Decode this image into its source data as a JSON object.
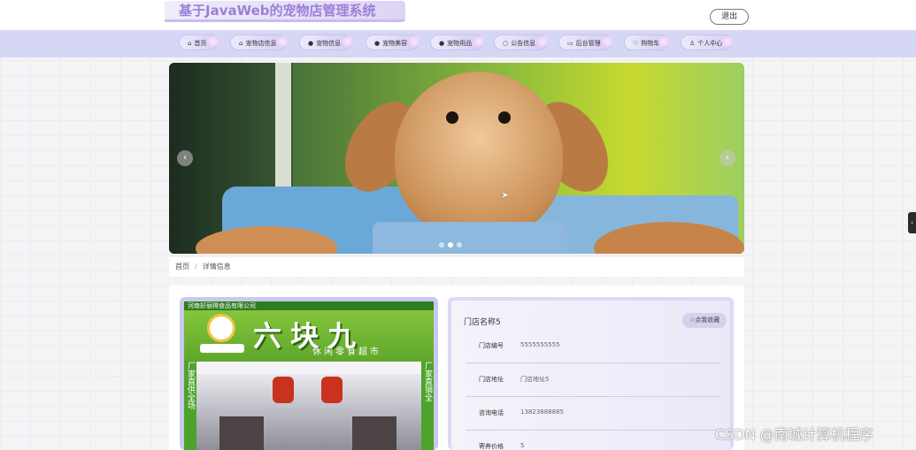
{
  "header": {
    "site_title": "基于JavaWeb的宠物店管理系统",
    "logout_label": "退出"
  },
  "nav": {
    "items": [
      {
        "label": "首页",
        "icon": "home-icon"
      },
      {
        "label": "宠物店信息",
        "icon": "shop-icon"
      },
      {
        "label": "宠物信息",
        "icon": "pet-icon"
      },
      {
        "label": "宠物美容",
        "icon": "grooming-icon"
      },
      {
        "label": "宠物用品",
        "icon": "supplies-icon"
      },
      {
        "label": "公告信息",
        "icon": "notice-icon"
      },
      {
        "label": "后台管理",
        "icon": "admin-icon"
      },
      {
        "label": "购物车",
        "icon": "cart-icon"
      },
      {
        "label": "个人中心",
        "icon": "user-icon"
      }
    ]
  },
  "banner": {
    "prev_glyph": "‹",
    "next_glyph": "›",
    "slide_count": 3,
    "active_slide": 2
  },
  "breadcrumb": {
    "home": "首页",
    "separator": "/",
    "current": "详情信息"
  },
  "shop_photo": {
    "top_text": "河南好丽得食品有限公司",
    "sign_main": "六块九",
    "sign_sub": "休闲零食超市",
    "side_left": "厂家直供全场",
    "side_right": "厂家直销全"
  },
  "detail": {
    "shop_name": "门店名称5",
    "favorite_label": "☆点我收藏",
    "fields": [
      {
        "label": "门店编号",
        "value": "5555555555"
      },
      {
        "label": "门店地址",
        "value": "门店地址5"
      },
      {
        "label": "咨询电话",
        "value": "13823888885"
      },
      {
        "label": "寄养价格",
        "value": "5"
      }
    ]
  },
  "watermark": "CSDN @南城计算机程序",
  "colors": {
    "accent": "#9b7fd6",
    "nav_bg": "#d6d7f4"
  }
}
